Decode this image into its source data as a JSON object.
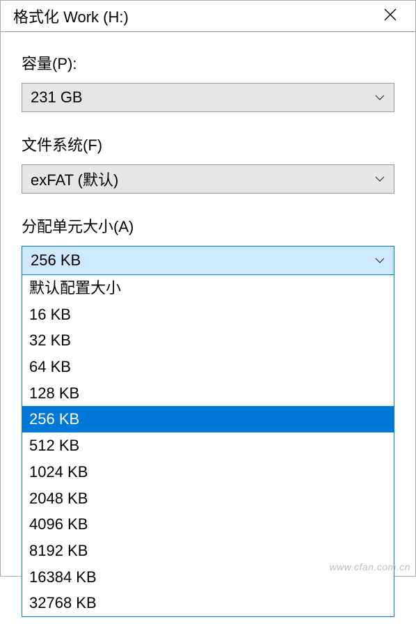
{
  "titlebar": {
    "title": "格式化 Work (H:)"
  },
  "capacity": {
    "label": "容量(P):",
    "value": "231 GB"
  },
  "filesystem": {
    "label": "文件系统(F)",
    "value": "exFAT (默认)"
  },
  "allocation": {
    "label": "分配单元大小(A)",
    "value": "256 KB",
    "options": [
      "默认配置大小",
      "16 KB",
      "32 KB",
      "64 KB",
      "128 KB",
      "256 KB",
      "512 KB",
      "1024 KB",
      "2048 KB",
      "4096 KB",
      "8192 KB",
      "16384 KB",
      "32768 KB"
    ],
    "selected_index": 5
  },
  "watermark": "www.cfan.com.cn"
}
